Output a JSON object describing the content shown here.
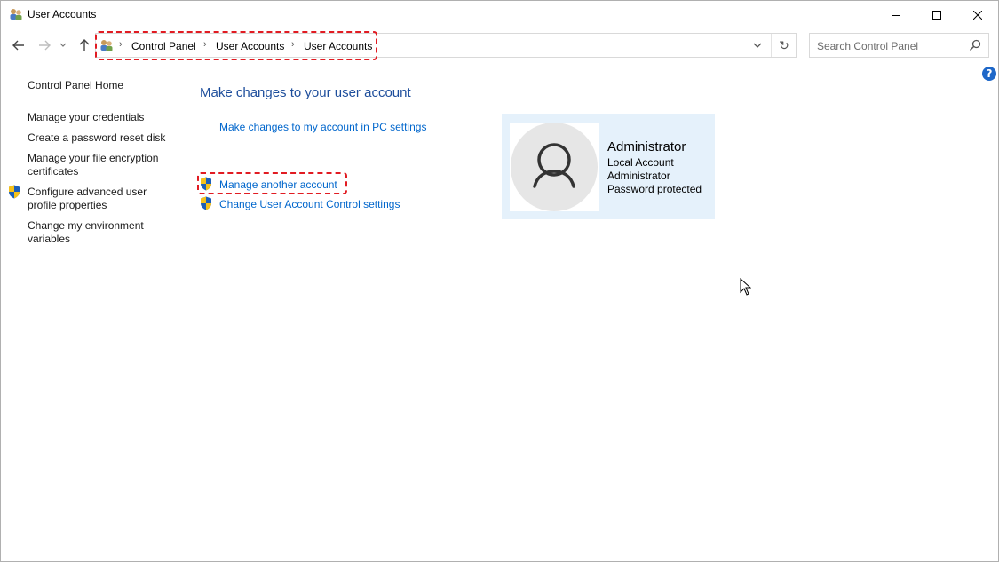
{
  "window": {
    "title": "User Accounts",
    "icon": "user-accounts-icon"
  },
  "breadcrumb": {
    "items": [
      "Control Panel",
      "User Accounts",
      "User Accounts"
    ]
  },
  "search": {
    "placeholder": "Search Control Panel"
  },
  "help": {
    "label": "?"
  },
  "sidebar": {
    "items": [
      {
        "label": "Control Panel Home"
      },
      {
        "label": "Manage your credentials"
      },
      {
        "label": "Create a password reset disk"
      },
      {
        "label": "Manage your file encryption certificates"
      },
      {
        "label": "Configure advanced user profile properties",
        "icon": "uac-shield-icon"
      },
      {
        "label": "Change my environment variables"
      }
    ]
  },
  "main": {
    "title": "Make changes to your user account",
    "links": [
      {
        "label": "Make changes to my account in PC settings"
      },
      {
        "label": "Manage another account",
        "icon": "uac-shield-icon"
      },
      {
        "label": "Change User Account Control settings",
        "icon": "uac-shield-icon"
      }
    ]
  },
  "account": {
    "name": "Administrator",
    "details": [
      "Local Account",
      "Administrator",
      "Password protected"
    ]
  },
  "colors": {
    "link": "#0066cc",
    "title": "#1e4e9c",
    "card_bg": "#e5f1fb",
    "highlight": "#e11b22"
  }
}
